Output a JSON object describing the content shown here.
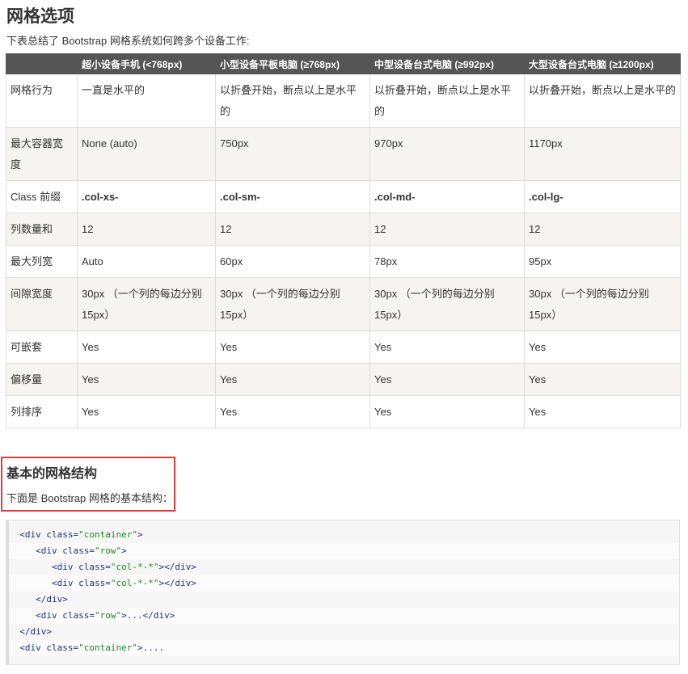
{
  "page": {
    "title": "网格选项",
    "intro": "下表总结了 Bootstrap 网格系统如何跨多个设备工作:"
  },
  "table": {
    "headers": [
      "",
      "超小设备手机 (<768px)",
      "小型设备平板电脑 (≥768px)",
      "中型设备台式电脑 (≥992px)",
      "大型设备台式电脑 (≥1200px)"
    ],
    "rows": [
      {
        "label": "网格行为",
        "cells": [
          "一直是水平的",
          "以折叠开始，断点以上是水平的",
          "以折叠开始，断点以上是水平的",
          "以折叠开始，断点以上是水平的"
        ]
      },
      {
        "label": "最大容器宽度",
        "cells": [
          "None (auto)",
          "750px",
          "970px",
          "1170px"
        ]
      },
      {
        "label": "Class 前缀",
        "cells": [
          ".col-xs-",
          ".col-sm-",
          ".col-md-",
          ".col-lg-"
        ],
        "bold": true
      },
      {
        "label": "列数量和",
        "cells": [
          "12",
          "12",
          "12",
          "12"
        ]
      },
      {
        "label": "最大列宽",
        "cells": [
          "Auto",
          "60px",
          "78px",
          "95px"
        ]
      },
      {
        "label": "间隙宽度",
        "cells": [
          "30px （一个列的每边分别 15px）",
          "30px （一个列的每边分别 15px）",
          "30px （一个列的每边分别 15px）",
          "30px （一个列的每边分别 15px）"
        ]
      },
      {
        "label": "可嵌套",
        "cells": [
          "Yes",
          "Yes",
          "Yes",
          "Yes"
        ]
      },
      {
        "label": "偏移量",
        "cells": [
          "Yes",
          "Yes",
          "Yes",
          "Yes"
        ]
      },
      {
        "label": "列排序",
        "cells": [
          "Yes",
          "Yes",
          "Yes",
          "Yes"
        ]
      }
    ]
  },
  "section": {
    "title": "基本的网格结构",
    "intro": "下面是 Bootstrap 网格的基本结构："
  },
  "code": {
    "lines": [
      {
        "indent": "  ",
        "tokens": [
          [
            "tag",
            "<div "
          ],
          [
            "attr",
            "class="
          ],
          [
            "val",
            "\"container\""
          ],
          [
            "tag",
            ">"
          ]
        ]
      },
      {
        "indent": "     ",
        "tokens": [
          [
            "tag",
            "<div "
          ],
          [
            "attr",
            "class="
          ],
          [
            "val",
            "\"row\""
          ],
          [
            "tag",
            ">"
          ]
        ]
      },
      {
        "indent": "        ",
        "tokens": [
          [
            "tag",
            "<div "
          ],
          [
            "attr",
            "class="
          ],
          [
            "val",
            "\"col-*-*\""
          ],
          [
            "tag",
            "></div>"
          ]
        ]
      },
      {
        "indent": "        ",
        "tokens": [
          [
            "tag",
            "<div "
          ],
          [
            "attr",
            "class="
          ],
          [
            "val",
            "\"col-*-*\""
          ],
          [
            "tag",
            "></div>"
          ]
        ]
      },
      {
        "indent": "     ",
        "tokens": [
          [
            "tag",
            "</div>"
          ]
        ]
      },
      {
        "indent": "     ",
        "tokens": [
          [
            "tag",
            "<div "
          ],
          [
            "attr",
            "class="
          ],
          [
            "val",
            "\"row\""
          ],
          [
            "tag",
            ">...</div>"
          ]
        ]
      },
      {
        "indent": "  ",
        "tokens": [
          [
            "tag",
            "</div>"
          ]
        ]
      },
      {
        "indent": "  ",
        "tokens": [
          [
            "tag",
            "<div "
          ],
          [
            "attr",
            "class="
          ],
          [
            "val",
            "\"container\""
          ],
          [
            "tag",
            ">...."
          ]
        ]
      }
    ]
  },
  "colors": {
    "header_bg": "#555555",
    "stripe_bg": "#f5f4f0",
    "highlight_border": "#e03a3a",
    "code_bg": "#f6f6f6"
  }
}
